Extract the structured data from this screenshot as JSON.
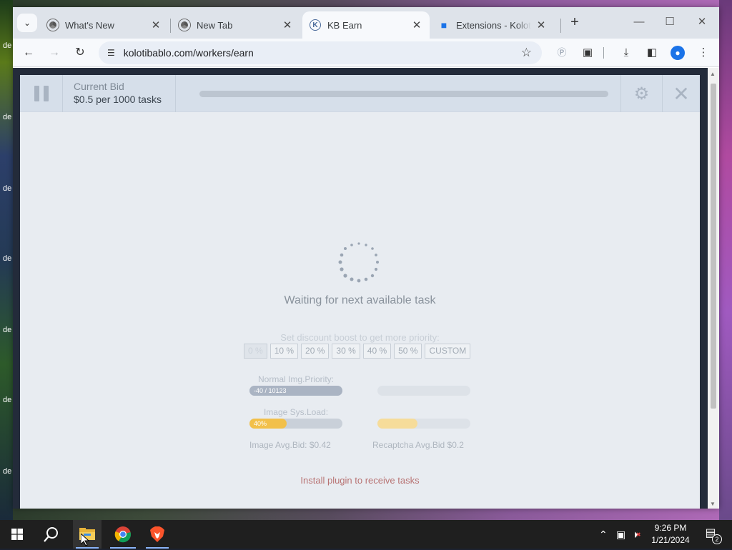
{
  "browser": {
    "tabs": [
      {
        "label": "What's New",
        "icon": "chrome-icon"
      },
      {
        "label": "New Tab",
        "icon": "chrome-icon"
      },
      {
        "label": "KB Earn",
        "icon": "kolotibablo-icon",
        "active": true
      },
      {
        "label": "Extensions - Kolotibablo",
        "icon": "puzzle-icon"
      }
    ],
    "url": "kolotibablo.com/workers/earn"
  },
  "panel": {
    "bid_label": "Current Bid",
    "bid_value": "$0.5 per 1000 tasks",
    "waiting": "Waiting for next available task",
    "boost_label": "Set discount boost to get more priority:",
    "boost_options": [
      "0 %",
      "10 %",
      "20 %",
      "30 %",
      "40 %",
      "50 %",
      "CUSTOM"
    ],
    "normal_priority_label": "Normal Img.Priority:",
    "normal_priority_value": "-40 / 10123",
    "image_load_label": "Image Sys.Load:",
    "image_load_value": "40%",
    "image_load_fraction": 0.4,
    "image_avg_bid": "Image Avg.Bid: $0.42",
    "recaptcha_avg_bid": "Recaptcha Avg.Bid $0.2",
    "install_text": "Install plugin to receive tasks"
  },
  "taskbar": {
    "time": "9:26 PM",
    "date": "1/21/2024",
    "notifications": "2"
  },
  "colors": {
    "load_fill": "#f2c04a",
    "priority_fill": "#aab4c3",
    "install_text": "#b87373"
  }
}
